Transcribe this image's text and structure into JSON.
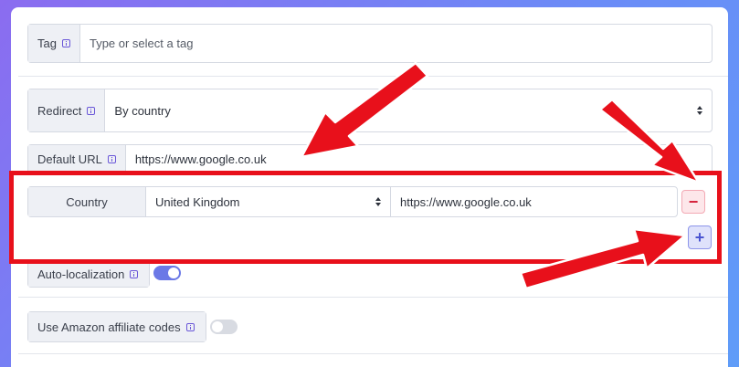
{
  "tag": {
    "label": "Tag",
    "placeholder": "Type or select a tag"
  },
  "redirect": {
    "label": "Redirect",
    "value": "By country"
  },
  "default_url": {
    "label": "Default URL",
    "value": "https://www.google.co.uk"
  },
  "country_rule": {
    "label": "Country",
    "country": "United Kingdom",
    "url": "https://www.google.co.uk",
    "remove_symbol": "−",
    "add_symbol": "+"
  },
  "auto_localization": {
    "label": "Auto-localization",
    "enabled": true
  },
  "amazon": {
    "label": "Use Amazon affiliate codes",
    "enabled": false
  },
  "colors": {
    "annotation_red": "#e8101b",
    "accent": "#6b78e6",
    "background": "#7b7cf4"
  }
}
